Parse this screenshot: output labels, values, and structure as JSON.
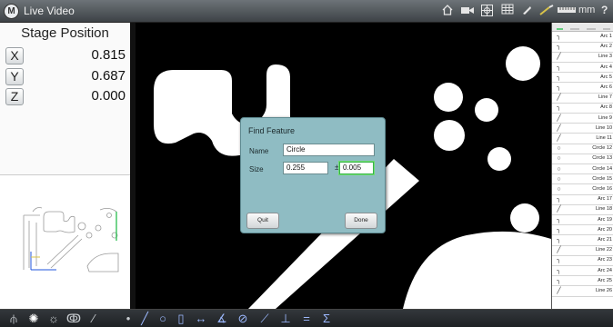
{
  "window": {
    "title": "Live Video",
    "logo_letter": "M",
    "unit": "mm",
    "help_label": "?",
    "toolbar_icons": [
      "home-icon",
      "camera-icon",
      "crosshair-icon",
      "grid-icon",
      "light-icon",
      "probe-icon",
      "ruler-icon"
    ]
  },
  "stage": {
    "title": "Stage Position",
    "axes": [
      {
        "label": "X",
        "value": "0.815"
      },
      {
        "label": "Y",
        "value": "0.687"
      },
      {
        "label": "Z",
        "value": "0.000"
      }
    ]
  },
  "dialog": {
    "title": "Find Feature",
    "name_label": "Name",
    "name_value": "Circle",
    "size_label": "Size",
    "size_value": "0.255",
    "plusminus": "±",
    "tolerance_value": "0.005",
    "quit_label": "Quit",
    "done_label": "Done"
  },
  "features": [
    {
      "icon": "arc",
      "name": "Arc 1"
    },
    {
      "icon": "arc",
      "name": "Arc 2"
    },
    {
      "icon": "line",
      "name": "Line 3"
    },
    {
      "icon": "arc",
      "name": "Arc 4"
    },
    {
      "icon": "arc",
      "name": "Arc 5"
    },
    {
      "icon": "arc",
      "name": "Arc 6"
    },
    {
      "icon": "line",
      "name": "Line 7"
    },
    {
      "icon": "arc",
      "name": "Arc 8"
    },
    {
      "icon": "line",
      "name": "Line 9"
    },
    {
      "icon": "line",
      "name": "Line 10"
    },
    {
      "icon": "line",
      "name": "Line 11"
    },
    {
      "icon": "circle",
      "name": "Circle 12"
    },
    {
      "icon": "circle",
      "name": "Circle 13"
    },
    {
      "icon": "circle",
      "name": "Circle 14"
    },
    {
      "icon": "circle",
      "name": "Circle 15"
    },
    {
      "icon": "circle",
      "name": "Circle 16"
    },
    {
      "icon": "arc",
      "name": "Arc 17"
    },
    {
      "icon": "line",
      "name": "Line 18"
    },
    {
      "icon": "arc",
      "name": "Arc 19"
    },
    {
      "icon": "arc",
      "name": "Arc 20"
    },
    {
      "icon": "arc",
      "name": "Arc 21"
    },
    {
      "icon": "line",
      "name": "Line 22"
    },
    {
      "icon": "arc",
      "name": "Arc 23"
    },
    {
      "icon": "arc",
      "name": "Arc 24"
    },
    {
      "icon": "arc",
      "name": "Arc 25"
    },
    {
      "icon": "line",
      "name": "Line 26"
    }
  ],
  "bottom_toolbar": [
    {
      "icon": "probe-tool-icon",
      "glyph": "⫛"
    },
    {
      "icon": "measure-magic-icon",
      "glyph": "✺"
    },
    {
      "icon": "focus-icon",
      "glyph": "☼"
    },
    {
      "icon": "edge-icon",
      "glyph": "ↂ"
    },
    {
      "icon": "slash-icon",
      "glyph": "⁄"
    },
    {
      "icon": "point-icon",
      "glyph": "•"
    },
    {
      "icon": "line-tool-icon",
      "glyph": "╱"
    },
    {
      "icon": "circle-tool-icon",
      "glyph": "○"
    },
    {
      "icon": "slot-tool-icon",
      "glyph": "▯"
    },
    {
      "icon": "distance-tool-icon",
      "glyph": "↔"
    },
    {
      "icon": "angle-tool-icon",
      "glyph": "∡"
    },
    {
      "icon": "plane-tool-icon",
      "glyph": "⊘"
    },
    {
      "icon": "skew-tool-icon",
      "glyph": "⟋"
    },
    {
      "icon": "perpendicular-tool-icon",
      "glyph": "⊥"
    },
    {
      "icon": "parallel-tool-icon",
      "glyph": "="
    },
    {
      "icon": "sum-tool-icon",
      "glyph": "Σ"
    }
  ],
  "colors": {
    "dialog_bg": "#8fbcc3",
    "focus_green": "#37b34a",
    "video_bg": "#000000",
    "part_white": "#ffffff"
  }
}
